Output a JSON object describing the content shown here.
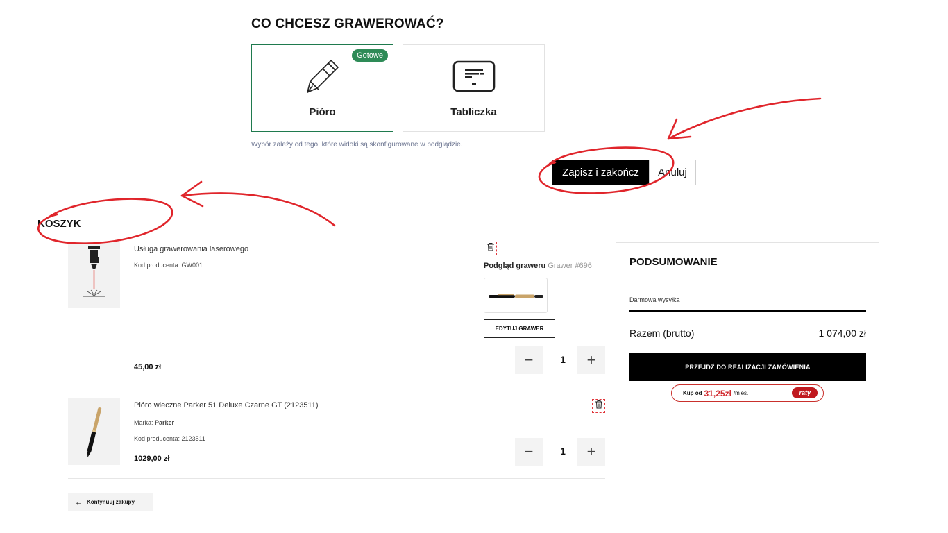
{
  "engrave": {
    "title": "CO CHCESZ GRAWEROWAĆ?",
    "options": [
      {
        "label": "Pióro",
        "badge": "Gotowe",
        "selected": true,
        "icon": "pen-icon"
      },
      {
        "label": "Tabliczka",
        "selected": false,
        "icon": "plaque-icon"
      }
    ],
    "hint": "Wybór zależy od tego, które widoki są skonfigurowane w podglądzie.",
    "save_label": "Zapisz i zakończ",
    "cancel_label": "Anuluj"
  },
  "cart": {
    "title": "KOSZYK",
    "items": [
      {
        "name": "Usługa grawerowania laserowego",
        "code": "Kod producenta: GW001",
        "price": "45,00 zł",
        "quantity": "1",
        "preview_label": "Podgląd graweru",
        "preview_id": "Grawer #696",
        "edit_label": "EDYTUJ GRAWER"
      },
      {
        "name": "Pióro wieczne Parker 51 Deluxe Czarne GT (2123511)",
        "brand_label": "Marka:",
        "brand": "Parker",
        "code": "Kod producenta: 2123511",
        "price": "1029,00 zł",
        "quantity": "1"
      }
    ],
    "continue_label": "Kontynuuj zakupy"
  },
  "summary": {
    "title": "PODSUMOWANIE",
    "shipping": "Darmowa wysyłka",
    "total_label": "Razem (brutto)",
    "total_value": "1 074,00 zł",
    "checkout_label": "PRZEJDŹ DO REALIZACJI ZAMÓWIENIA",
    "installment_prefix": "Kup od",
    "installment_amount": "31,25zł",
    "installment_suffix": "/mies.",
    "installment_badge": "raty"
  },
  "colors": {
    "accent_green": "#2e8b57",
    "annotation_red": "#e0252b",
    "raty_red": "#c0191f"
  }
}
